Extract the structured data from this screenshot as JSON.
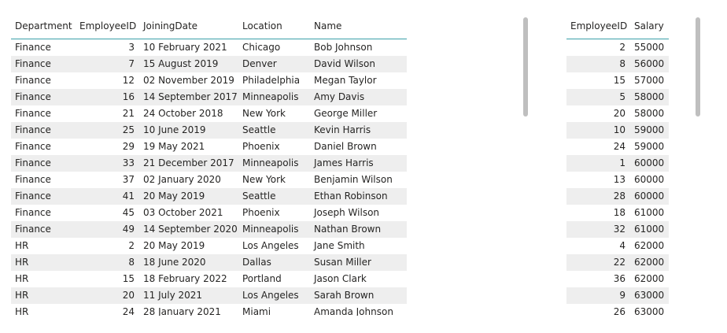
{
  "employees_table": {
    "columns": [
      "Department",
      "EmployeeID",
      "JoiningDate",
      "Location",
      "Name"
    ],
    "rows": [
      {
        "department": "Finance",
        "employee_id": "3",
        "joining_date": "10 February 2021",
        "location": "Chicago",
        "name": "Bob Johnson"
      },
      {
        "department": "Finance",
        "employee_id": "7",
        "joining_date": "15 August 2019",
        "location": "Denver",
        "name": "David Wilson"
      },
      {
        "department": "Finance",
        "employee_id": "12",
        "joining_date": "02 November 2019",
        "location": "Philadelphia",
        "name": "Megan Taylor"
      },
      {
        "department": "Finance",
        "employee_id": "16",
        "joining_date": "14 September 2017",
        "location": "Minneapolis",
        "name": "Amy Davis"
      },
      {
        "department": "Finance",
        "employee_id": "21",
        "joining_date": "24 October 2018",
        "location": "New York",
        "name": "George Miller"
      },
      {
        "department": "Finance",
        "employee_id": "25",
        "joining_date": "10 June 2019",
        "location": "Seattle",
        "name": "Kevin Harris"
      },
      {
        "department": "Finance",
        "employee_id": "29",
        "joining_date": "19 May 2021",
        "location": "Phoenix",
        "name": "Daniel Brown"
      },
      {
        "department": "Finance",
        "employee_id": "33",
        "joining_date": "21 December 2017",
        "location": "Minneapolis",
        "name": "James Harris"
      },
      {
        "department": "Finance",
        "employee_id": "37",
        "joining_date": "02 January 2020",
        "location": "New York",
        "name": "Benjamin Wilson"
      },
      {
        "department": "Finance",
        "employee_id": "41",
        "joining_date": "20 May 2019",
        "location": "Seattle",
        "name": "Ethan Robinson"
      },
      {
        "department": "Finance",
        "employee_id": "45",
        "joining_date": "03 October 2021",
        "location": "Phoenix",
        "name": "Joseph Wilson"
      },
      {
        "department": "Finance",
        "employee_id": "49",
        "joining_date": "14 September 2020",
        "location": "Minneapolis",
        "name": "Nathan Brown"
      },
      {
        "department": "HR",
        "employee_id": "2",
        "joining_date": "20 May 2019",
        "location": "Los Angeles",
        "name": "Jane Smith"
      },
      {
        "department": "HR",
        "employee_id": "8",
        "joining_date": "18 June 2020",
        "location": "Dallas",
        "name": "Susan Miller"
      },
      {
        "department": "HR",
        "employee_id": "15",
        "joining_date": "18 February 2022",
        "location": "Portland",
        "name": "Jason Clark"
      },
      {
        "department": "HR",
        "employee_id": "20",
        "joining_date": "11 July 2021",
        "location": "Los Angeles",
        "name": "Sarah Brown"
      },
      {
        "department": "HR",
        "employee_id": "24",
        "joining_date": "28 January 2021",
        "location": "Miami",
        "name": "Amanda Johnson"
      }
    ]
  },
  "salaries_table": {
    "columns": [
      "EmployeeID",
      "Salary"
    ],
    "rows": [
      {
        "employee_id": "2",
        "salary": "55000"
      },
      {
        "employee_id": "8",
        "salary": "56000"
      },
      {
        "employee_id": "15",
        "salary": "57000"
      },
      {
        "employee_id": "5",
        "salary": "58000"
      },
      {
        "employee_id": "20",
        "salary": "58000"
      },
      {
        "employee_id": "10",
        "salary": "59000"
      },
      {
        "employee_id": "24",
        "salary": "59000"
      },
      {
        "employee_id": "1",
        "salary": "60000"
      },
      {
        "employee_id": "13",
        "salary": "60000"
      },
      {
        "employee_id": "28",
        "salary": "60000"
      },
      {
        "employee_id": "18",
        "salary": "61000"
      },
      {
        "employee_id": "32",
        "salary": "61000"
      },
      {
        "employee_id": "4",
        "salary": "62000"
      },
      {
        "employee_id": "22",
        "salary": "62000"
      },
      {
        "employee_id": "36",
        "salary": "62000"
      },
      {
        "employee_id": "9",
        "salary": "63000"
      },
      {
        "employee_id": "26",
        "salary": "63000"
      }
    ]
  },
  "colors": {
    "header_underline": "#3aa0a8",
    "alt_row": "#eeeeee",
    "scrollbar": "#bfbfbf"
  }
}
